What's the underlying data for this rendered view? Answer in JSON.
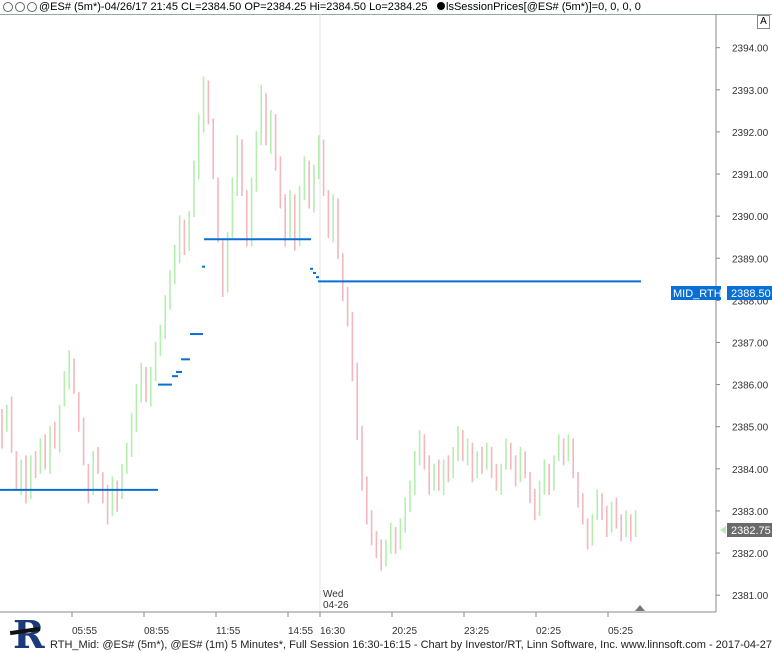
{
  "titlebar": {
    "text": "@ES# (5m*)-04/26/17 21:45 CL=2384.50 OP=2384.25 Hi=2384.50 Lo=2384.25",
    "indicator": "lsSessionPrices[@ES# (5m*)]=0, 0, 0, 0"
  },
  "a_button": "A",
  "footer": "RTH_Mid: @ES# (5m*), @ES# (1m) 5 Minutes*, Full Session 16:30-16:15 - Chart by Investor/RT, Linn Software, Inc. www.linnsoft.com - 2017-04-27",
  "logo_letter": "R",
  "colors": {
    "up": "#b4efb0",
    "down": "#f2b8bd",
    "level_line": "#0a6fd4",
    "axis_tag_gray": "#6a6a6a"
  },
  "chart_data": {
    "type": "bar",
    "ylim": [
      2380.6,
      2394.8
    ],
    "y_ticks": [
      "2394.00",
      "2393.00",
      "2392.00",
      "2391.00",
      "2390.00",
      "2389.00",
      "2388.00",
      "2387.00",
      "2386.00",
      "2385.00",
      "2384.00",
      "2383.00",
      "2382.00",
      "2381.00"
    ],
    "x_ticks": [
      "05:55",
      "08:55",
      "11:55",
      "14:55",
      "16:30",
      "20:25",
      "23:25",
      "02:25",
      "05:25"
    ],
    "session_marker": {
      "day": "Wed",
      "date": "04-26"
    },
    "mid_rth_label": "MID_RTH",
    "mid_rth_value": "2388.50",
    "last_price_value": "2382.75",
    "bars": [
      [
        0,
        2385.3,
        2384.6
      ],
      [
        1,
        2385.0,
        2385.4
      ],
      [
        2,
        2385.6,
        2384.5
      ],
      [
        3,
        2384.3,
        2383.6
      ],
      [
        4,
        2383.5,
        2384.1
      ],
      [
        5,
        2384.2,
        2383.3
      ],
      [
        6,
        2383.4,
        2384.2
      ],
      [
        7,
        2384.3,
        2383.9
      ],
      [
        8,
        2384.0,
        2384.6
      ],
      [
        9,
        2384.7,
        2384.1
      ],
      [
        10,
        2384.0,
        2384.9
      ],
      [
        11,
        2385.0,
        2384.6
      ],
      [
        12,
        2384.5,
        2385.4
      ],
      [
        13,
        2385.6,
        2386.2
      ],
      [
        14,
        2386.0,
        2386.7
      ],
      [
        15,
        2386.5,
        2385.9
      ],
      [
        16,
        2385.7,
        2385.0
      ],
      [
        17,
        2385.1,
        2384.2
      ],
      [
        18,
        2384.0,
        2383.3
      ],
      [
        19,
        2383.5,
        2384.3
      ],
      [
        20,
        2384.4,
        2384.0
      ],
      [
        21,
        2383.8,
        2383.3
      ],
      [
        22,
        2383.5,
        2382.8
      ],
      [
        23,
        2383.0,
        2383.7
      ],
      [
        24,
        2383.6,
        2383.1
      ],
      [
        25,
        2383.4,
        2384.0
      ],
      [
        26,
        2384.0,
        2384.5
      ],
      [
        27,
        2384.4,
        2385.2
      ],
      [
        28,
        2385.0,
        2385.9
      ],
      [
        29,
        2385.7,
        2386.4
      ],
      [
        30,
        2386.3,
        2385.7
      ],
      [
        31,
        2385.6,
        2386.3
      ],
      [
        32,
        2386.2,
        2386.9
      ],
      [
        33,
        2386.8,
        2387.3
      ],
      [
        34,
        2387.2,
        2388.0
      ],
      [
        35,
        2387.9,
        2388.6
      ],
      [
        36,
        2388.5,
        2389.2
      ],
      [
        37,
        2389.0,
        2389.9
      ],
      [
        38,
        2389.8,
        2389.2
      ],
      [
        39,
        2389.3,
        2390.0
      ],
      [
        40,
        2390.1,
        2391.2
      ],
      [
        41,
        2391.0,
        2392.3
      ],
      [
        42,
        2392.1,
        2393.2
      ],
      [
        43,
        2393.1,
        2392.3
      ],
      [
        44,
        2392.2,
        2391.0
      ],
      [
        45,
        2390.8,
        2389.5
      ],
      [
        46,
        2389.3,
        2388.2
      ],
      [
        47,
        2388.3,
        2389.5
      ],
      [
        48,
        2389.6,
        2390.8
      ],
      [
        49,
        2390.6,
        2391.8
      ],
      [
        50,
        2391.7,
        2390.6
      ],
      [
        51,
        2390.5,
        2389.4
      ],
      [
        52,
        2389.4,
        2390.8
      ],
      [
        53,
        2390.7,
        2391.9
      ],
      [
        54,
        2391.8,
        2393.0
      ],
      [
        55,
        2392.8,
        2391.8
      ],
      [
        56,
        2391.6,
        2392.4
      ],
      [
        57,
        2392.3,
        2391.2
      ],
      [
        58,
        2391.3,
        2390.3
      ],
      [
        59,
        2390.4,
        2389.4
      ],
      [
        60,
        2389.6,
        2390.5
      ],
      [
        61,
        2390.4,
        2389.3
      ],
      [
        62,
        2389.4,
        2390.6
      ],
      [
        63,
        2390.5,
        2391.3
      ],
      [
        64,
        2391.2,
        2390.3
      ],
      [
        65,
        2390.2,
        2391.1
      ],
      [
        66,
        2391.0,
        2391.8
      ],
      [
        67,
        2391.7,
        2390.6
      ],
      [
        68,
        2390.5,
        2389.6
      ],
      [
        69,
        2389.5,
        2390.4
      ],
      [
        70,
        2390.3,
        2389.1
      ],
      [
        71,
        2389.0,
        2388.1
      ],
      [
        72,
        2388.2,
        2387.5
      ],
      [
        73,
        2387.6,
        2386.2
      ],
      [
        74,
        2386.4,
        2384.8
      ],
      [
        75,
        2384.9,
        2383.6
      ],
      [
        76,
        2383.7,
        2382.8
      ],
      [
        77,
        2382.9,
        2382.3
      ],
      [
        78,
        2382.4,
        2382.0
      ],
      [
        79,
        2382.2,
        2381.7
      ],
      [
        80,
        2381.8,
        2382.2
      ],
      [
        81,
        2382.1,
        2382.6
      ],
      [
        82,
        2382.5,
        2382.1
      ],
      [
        83,
        2382.2,
        2382.7
      ],
      [
        84,
        2382.6,
        2383.2
      ],
      [
        85,
        2383.1,
        2383.6
      ],
      [
        86,
        2383.5,
        2384.3
      ],
      [
        87,
        2384.2,
        2384.8
      ],
      [
        88,
        2384.7,
        2384.1
      ],
      [
        89,
        2384.2,
        2383.5
      ],
      [
        90,
        2383.6,
        2384.0
      ],
      [
        91,
        2384.1,
        2383.6
      ],
      [
        92,
        2383.5,
        2384.1
      ],
      [
        93,
        2384.2,
        2383.8
      ],
      [
        94,
        2383.9,
        2384.4
      ],
      [
        95,
        2384.3,
        2384.9
      ],
      [
        96,
        2384.8,
        2384.3
      ],
      [
        97,
        2384.2,
        2384.6
      ],
      [
        98,
        2384.5,
        2383.8
      ],
      [
        99,
        2383.9,
        2384.3
      ],
      [
        100,
        2384.4,
        2384.0
      ],
      [
        101,
        2384.1,
        2384.5
      ],
      [
        102,
        2384.4,
        2383.9
      ],
      [
        103,
        2384.0,
        2383.6
      ],
      [
        104,
        2383.5,
        2384.0
      ],
      [
        105,
        2384.1,
        2384.6
      ],
      [
        106,
        2384.5,
        2384.1
      ],
      [
        107,
        2384.2,
        2383.7
      ],
      [
        108,
        2383.8,
        2384.4
      ],
      [
        109,
        2384.3,
        2383.9
      ],
      [
        110,
        2383.8,
        2383.3
      ],
      [
        111,
        2383.4,
        2382.9
      ],
      [
        112,
        2383.0,
        2383.6
      ],
      [
        113,
        2383.5,
        2384.1
      ],
      [
        114,
        2384.0,
        2383.5
      ],
      [
        115,
        2383.6,
        2384.2
      ],
      [
        116,
        2384.3,
        2384.7
      ],
      [
        117,
        2384.6,
        2384.2
      ],
      [
        118,
        2384.3,
        2384.7
      ],
      [
        119,
        2384.6,
        2383.9
      ],
      [
        120,
        2383.8,
        2383.2
      ],
      [
        121,
        2383.3,
        2382.8
      ],
      [
        122,
        2382.7,
        2382.2
      ],
      [
        123,
        2382.3,
        2382.8
      ],
      [
        124,
        2382.9,
        2383.4
      ],
      [
        125,
        2383.3,
        2382.9
      ],
      [
        126,
        2383.0,
        2382.5
      ],
      [
        127,
        2382.6,
        2383.1
      ],
      [
        128,
        2383.2,
        2382.7
      ],
      [
        129,
        2382.8,
        2382.4
      ],
      [
        130,
        2382.5,
        2382.9
      ],
      [
        131,
        2382.8,
        2382.4
      ],
      [
        132,
        2382.5,
        2382.9
      ]
    ],
    "levels": [
      {
        "x0": 0,
        "x1": 158,
        "y": 2383.5
      },
      {
        "x0": 158,
        "x1": 172,
        "y": 2386.0
      },
      {
        "x0": 172,
        "x1": 178,
        "y": 2386.2
      },
      {
        "x0": 176,
        "x1": 182,
        "y": 2386.3
      },
      {
        "x0": 181,
        "x1": 190,
        "y": 2386.6
      },
      {
        "x0": 190,
        "x1": 203,
        "y": 2387.2
      },
      {
        "x0": 202,
        "x1": 205,
        "y": 2388.8
      },
      {
        "x0": 204,
        "x1": 311,
        "y": 2389.45
      },
      {
        "x0": 310,
        "x1": 313,
        "y": 2388.75
      },
      {
        "x0": 313,
        "x1": 316,
        "y": 2388.65
      },
      {
        "x0": 316,
        "x1": 319,
        "y": 2388.55
      },
      {
        "x0": 318,
        "x1": 641,
        "y": 2388.45
      }
    ]
  }
}
